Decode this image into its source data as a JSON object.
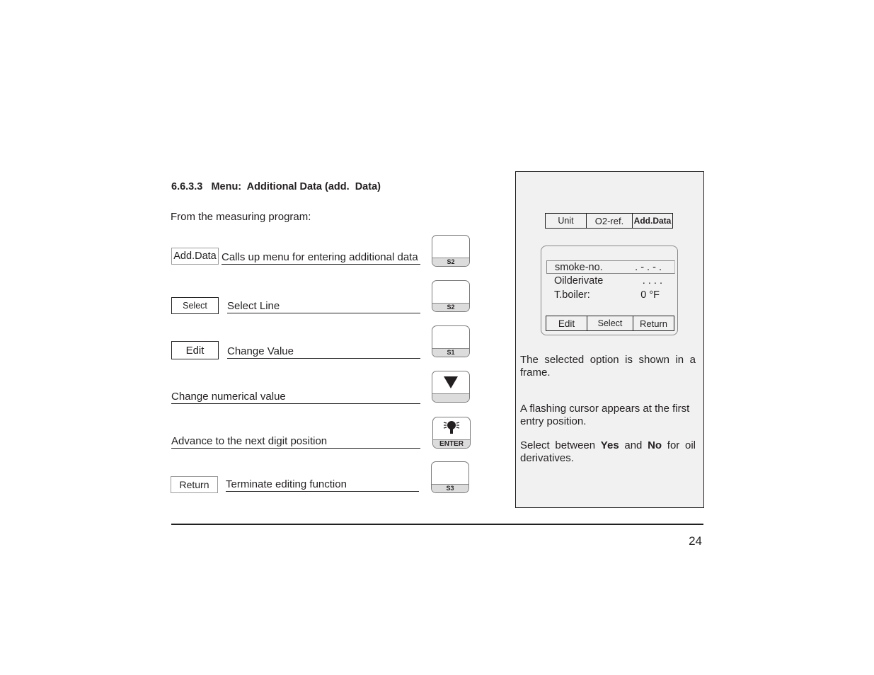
{
  "section": {
    "number": "6.6.3.3",
    "title": "Menu:  Additional Data (add.  Data)",
    "intro": "From the measuring program:"
  },
  "steps": [
    {
      "soft_label": "Add.Data",
      "description": "Calls up menu for entering additional data",
      "key": {
        "label": "S2",
        "icon": "blank-key"
      }
    },
    {
      "soft_label": "Select",
      "description": "Select Line",
      "key": {
        "label": "S2",
        "icon": "blank-key"
      }
    },
    {
      "soft_label": "Edit",
      "description": "Change Value",
      "key": {
        "label": "S1",
        "icon": "blank-key"
      }
    },
    {
      "soft_label": "",
      "description": "Change numerical value",
      "key": {
        "label": "",
        "icon": "down-triangle-icon"
      }
    },
    {
      "soft_label": "",
      "description": "Advance to the next digit position",
      "key": {
        "label": "ENTER",
        "icon": "light-bulb-icon"
      }
    },
    {
      "soft_label": "Return",
      "description": "Terminate editing function",
      "key": {
        "label": "S3",
        "icon": "blank-key"
      }
    }
  ],
  "panel": {
    "menu_bar": [
      "Unit",
      "O2-ref.",
      "Add.Data"
    ],
    "screen": {
      "lines": [
        {
          "label": "smoke-no.",
          "value": ". - . - .",
          "selected": true
        },
        {
          "label": "Oilderivate",
          "value": ". . . .",
          "selected": false
        },
        {
          "label": "T.boiler:",
          "value": "0 °F",
          "selected": false
        }
      ],
      "soft_keys": [
        "Edit",
        "Select",
        "Return"
      ]
    },
    "notes": {
      "p1": "The selected option is shown in a frame.",
      "p2": "A flashing cursor appears at the first entry position.",
      "p3_pre": "Select between ",
      "p3_yes": "Yes",
      "p3_mid": " and ",
      "p3_no": "No",
      "p3_post": " for oil derivatives."
    }
  },
  "footer": {
    "page_number": "24"
  }
}
